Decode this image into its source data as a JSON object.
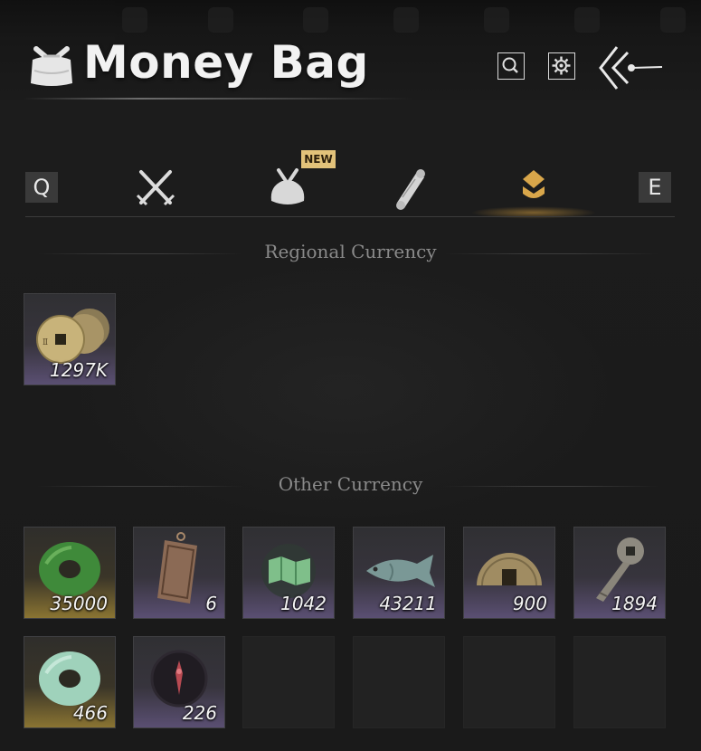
{
  "header": {
    "title": "Money Bag"
  },
  "tabs": {
    "prev_key": "Q",
    "next_key": "E",
    "new_badge": "NEW",
    "items": [
      "weapons-tab",
      "bags-tab",
      "scrolls-tab",
      "currency-tab"
    ],
    "active": "currency-tab"
  },
  "sections": {
    "regional": "Regional Currency",
    "other": "Other Currency"
  },
  "regional_items": [
    {
      "icon": "copper-coins-icon",
      "count": "1297K"
    }
  ],
  "other_items": [
    {
      "icon": "green-jade-disc-icon",
      "count": "35000"
    },
    {
      "icon": "bronze-tablet-icon",
      "count": "6"
    },
    {
      "icon": "jade-map-icon",
      "count": "1042"
    },
    {
      "icon": "jade-fish-icon",
      "count": "43211"
    },
    {
      "icon": "half-coin-icon",
      "count": "900"
    },
    {
      "icon": "coin-sword-icon",
      "count": "1894"
    },
    {
      "icon": "pale-jade-disc-icon",
      "count": "466"
    },
    {
      "icon": "red-token-icon",
      "count": "226"
    }
  ],
  "colors": {
    "accent_gold": "#d8a64a",
    "new_badge": "#e2c27a",
    "purple_rarity": "#5a4f72",
    "gold_rarity": "#8a7432"
  }
}
